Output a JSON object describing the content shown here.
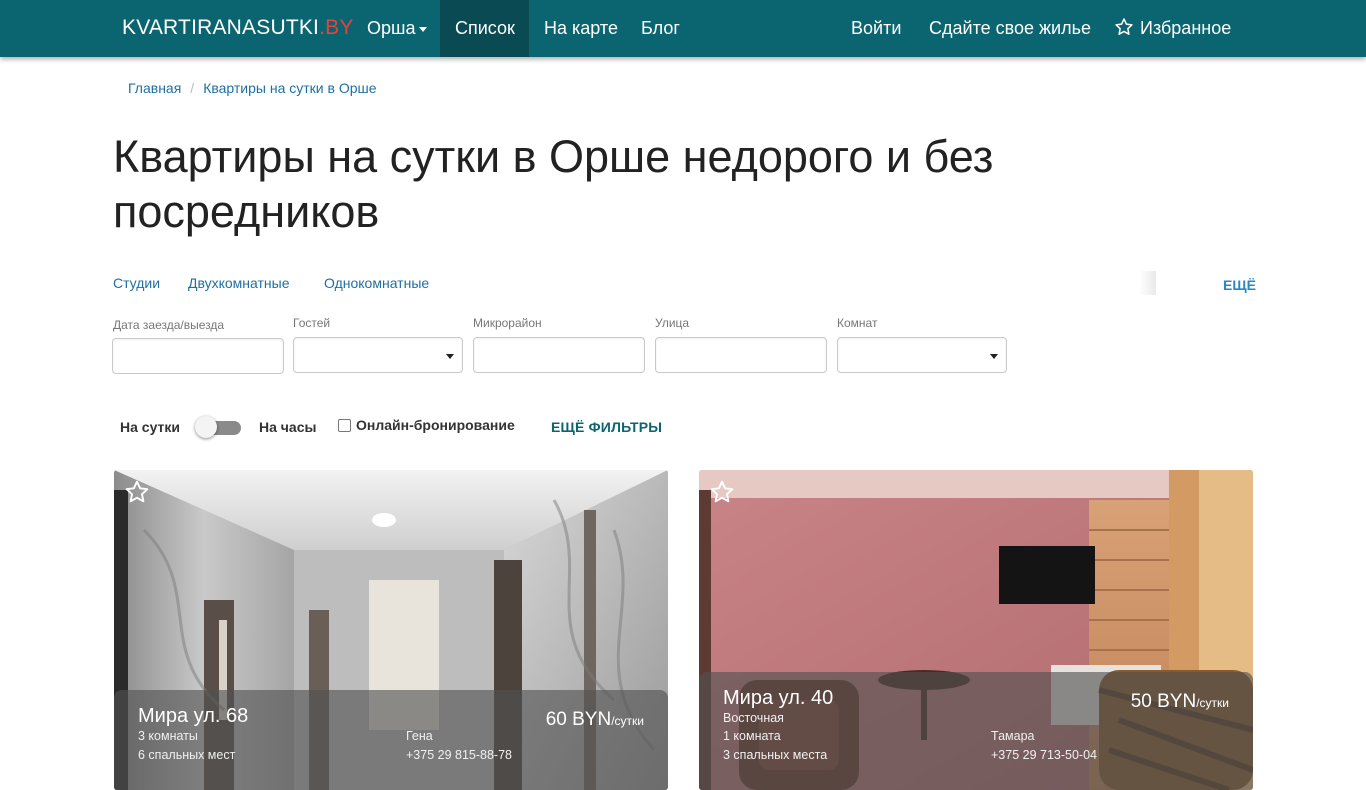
{
  "navbar": {
    "brand_main": "KVARTIRANASUTKI",
    "brand_suffix": ".BY",
    "city": "Орша",
    "list": "Список",
    "map": "На карте",
    "blog": "Блог",
    "login": "Войти",
    "rent_out": "Сдайте свое жилье",
    "favorites": "Избранное"
  },
  "breadcrumb": [
    "Главная",
    "Квартиры на сутки в Орше"
  ],
  "title": "Квартиры на сутки в Орше недорого и без посредников",
  "quick_links": [
    "Студии",
    "Двухкомнатные",
    "Однокомнатные"
  ],
  "quick_more": "ЕЩЁ",
  "filters": {
    "dates": "Дата заезда/выезда",
    "guests": "Гостей",
    "district": "Микрорайон",
    "street": "Улица",
    "rooms": "Комнат"
  },
  "mode": {
    "daily": "На сутки",
    "hourly": "На часы",
    "online": "Онлайн-бронирование",
    "more_filters": "ЕЩЁ ФИЛЬТРЫ"
  },
  "listings": [
    {
      "title": "Мира ул. 68",
      "district": "",
      "rooms": "3 комнаты",
      "beds": "6 спальных мест",
      "host": "Гена",
      "phone": "+375 29 815-88-78",
      "price": "60 BYN",
      "per": "/сутки"
    },
    {
      "title": "Мира ул. 40",
      "district": "Восточная",
      "rooms": "1 комната",
      "beds": "3 спальных места",
      "host": "Тамара",
      "phone": "+375 29 713-50-04",
      "price": "50 BYN",
      "per": "/сутки"
    }
  ],
  "colors": {
    "navbar": "#0b6571",
    "navbar_active": "#094a53",
    "link": "#1f6fa3",
    "brand_accent": "#e8413c"
  }
}
